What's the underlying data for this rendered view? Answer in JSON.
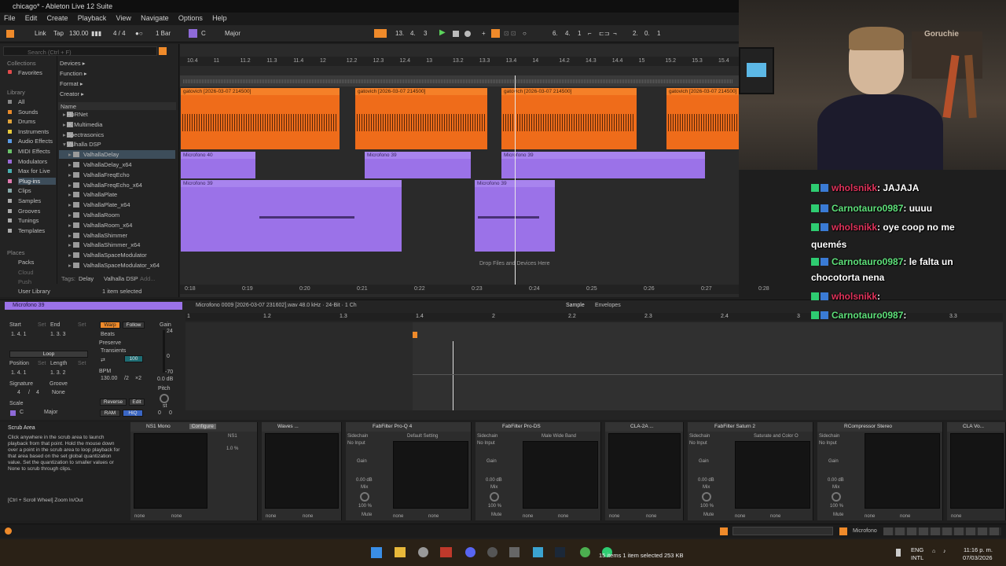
{
  "window": {
    "title": "chicago* - Ableton Live 12 Suite"
  },
  "menu": [
    "File",
    "Edit",
    "Create",
    "Playback",
    "View",
    "Navigate",
    "Options",
    "Help"
  ],
  "transport": {
    "link": "Link",
    "tap": "Tap",
    "tempo": "130.00",
    "signature": "4 / 4",
    "quantize": "1 Bar",
    "key": "C",
    "scale": "Major",
    "position": [
      "13.",
      "4.",
      "3"
    ],
    "loop_start": [
      "6.",
      "4.",
      "1"
    ],
    "loop_length": [
      "2.",
      "0.",
      "1"
    ]
  },
  "browser": {
    "search_placeholder": "Search (Ctrl + F)",
    "collections_header": "Collections",
    "favorites": "Favorites",
    "library_header": "Library",
    "library_items": [
      "All",
      "Sounds",
      "Drums",
      "Instruments",
      "Audio Effects",
      "MIDI Effects",
      "Modulators",
      "Max for Live",
      "Plug-ins",
      "Clips",
      "Samples",
      "Grooves",
      "Tunings",
      "Templates"
    ],
    "places_header": "Places",
    "places_items": [
      "Packs",
      "Cloud",
      "Push",
      "User Library"
    ],
    "filters": [
      "Devices ▸",
      "Function ▸",
      "Format ▸",
      "Creator ▸"
    ],
    "name_header": "Name",
    "files": [
      "HoRNet",
      "IK Multimedia",
      "Spectrasonics",
      "Valhalla DSP",
      "ValhallaDelay",
      "ValhallaDelay_x64",
      "ValhallaFreqEcho",
      "ValhallaFreqEcho_x64",
      "ValhallaPlate",
      "ValhallaPlate_x64",
      "ValhallaRoom",
      "ValhallaRoom_x64",
      "ValhallaShimmer",
      "ValhallaShimmer_x64",
      "ValhallaSpaceModulator",
      "ValhallaSpaceModulator_x64"
    ],
    "tags_label": "Tags:",
    "tag1": "Delay",
    "tag2": "Valhalla DSP",
    "tag_add": "Add...",
    "status": "1 item selected"
  },
  "arrangement": {
    "bar_ruler": [
      "10.4",
      "11",
      "11.2",
      "11.3",
      "11.4",
      "12",
      "12.2",
      "12.3",
      "12.4",
      "13",
      "13.2",
      "13.3",
      "13.4",
      "14",
      "14.2",
      "14.3",
      "14.4",
      "15",
      "15.2",
      "15.3",
      "15.4"
    ],
    "time_ruler": [
      "0:18",
      "0:19",
      "0:20",
      "0:21",
      "0:22",
      "0:23",
      "0:24",
      "0:25",
      "0:26",
      "0:27",
      "0:28"
    ],
    "clips": {
      "orange": "gatovich [2026-03-07 214500]",
      "mic40": "Microfono 40",
      "mic39": "Microfono 39"
    },
    "drop_hint": "Drop Files and Devices Here"
  },
  "clipview": {
    "track_name": "Microfono 39",
    "file_info": "Microfono 0009 [2026-03-07 231602].wav  48.0 kHz · 24-Bit · 1 Ch",
    "tabs": [
      "Sample",
      "Envelopes"
    ],
    "labels": {
      "start": "Start",
      "end": "End",
      "set": "Set",
      "loop": "Loop",
      "position": "Position",
      "length": "Length",
      "signature": "Signature",
      "groove": "Groove",
      "scale": "Scale",
      "warp": "Warp",
      "follow": "Follow",
      "preserve": "Preserve",
      "bpm": "BPM",
      "reverse": "Reverse",
      "edit": "Edit",
      "ram": "RAM",
      "hiq": "HiQ",
      "gain": "Gain",
      "pitch": "Pitch",
      "st": "st"
    },
    "values": {
      "start": "1.   4.   1",
      "end": "1.   3.   3",
      "position": "1.   4.   1",
      "length": "1.   3.   2",
      "sig_num": "4",
      "sig_den": "4",
      "groove": "None",
      "scale_key": "C",
      "scale_name": "Major",
      "warp_mode": "Beats",
      "preserve_mode": "Transients",
      "loop_mode": "⇄",
      "loop_pct": "100",
      "bpm": "130.00",
      "half": "/2",
      "double": "×2",
      "gain_db": "0.0 dB",
      "gain_24": "24",
      "gain_0": "0",
      "gain_70": "-70",
      "pitch_st": "0",
      "pitch_ct": "0"
    },
    "ruler": [
      "1",
      "1.2",
      "1.3",
      "1.4",
      "2",
      "2.2",
      "2.3",
      "2.4",
      "3",
      "3.2",
      "3.3"
    ]
  },
  "devices": {
    "info_title": "Scrub Area",
    "info_text": "Click anywhere in the scrub area to launch playback from that point. Hold the mouse down over a point in the scrub area to loop playback for that area based on the set global quantization value. Set the quantization to smaller values or None to scrub through clips.",
    "info_shortcut": "[Ctrl + Scroll Wheel] Zoom In/Out",
    "chain": [
      {
        "name": "NS1 Mono",
        "extra": "Configure"
      },
      {
        "name": "Waves ..."
      },
      {
        "name": "FabFilter Pro-Q 4"
      },
      {
        "name": "FabFilter Pro-DS"
      },
      {
        "name": "CLA-2A ..."
      },
      {
        "name": "FabFilter Saturn 2"
      },
      {
        "name": "RCompressor Stereo"
      },
      {
        "name": "CLA Vo..."
      }
    ],
    "ns1": {
      "label": "NS1",
      "value": "1.0 %"
    },
    "common": {
      "sidechain": "Sidechain",
      "no_input": "No Input",
      "gain": "Gain",
      "gain_val": "0.00 dB",
      "mix": "Mix",
      "mix_val": "100 %",
      "mute": "Mute",
      "none": "none"
    },
    "presets": [
      "Default Setting",
      "Male Wide Band",
      "Saturate and Color O"
    ]
  },
  "statusbar": {
    "track": "Microfono"
  },
  "taskbar": {
    "status_text": "15 items    1 item selected  253 KB",
    "lang": "ENG",
    "region": "INTL",
    "time": "11:16 p. m.",
    "date": "07/03/2026"
  },
  "chat": [
    {
      "user": "wholsnikk",
      "msg": ": JAJAJA",
      "color": "#e0335b"
    },
    {
      "user": "Carnotauro0987",
      "msg": ": uuuu",
      "color": "#5ee07a"
    },
    {
      "user": "wholsnikk",
      "msg": ": oye coop no me",
      "color": "#e0335b"
    },
    {
      "user": "",
      "msg": "quemés",
      "color": "#ffffff"
    },
    {
      "user": "Carnotauro0987",
      "msg": ": le falta un",
      "color": "#5ee07a"
    },
    {
      "user": "",
      "msg": "chocotorta nena",
      "color": "#ffffff"
    },
    {
      "user": "wholsnikk",
      "msg": ":",
      "color": "#e0335b"
    },
    {
      "user": "Carnotauro0987",
      "msg": ":",
      "color": "#5ee07a"
    }
  ],
  "webcam": {
    "sign": "Goruchie"
  },
  "colors": {
    "accent": "#ef8a2a",
    "clip_orange": "#ef6c1a",
    "clip_purple": "#9b72e8"
  }
}
